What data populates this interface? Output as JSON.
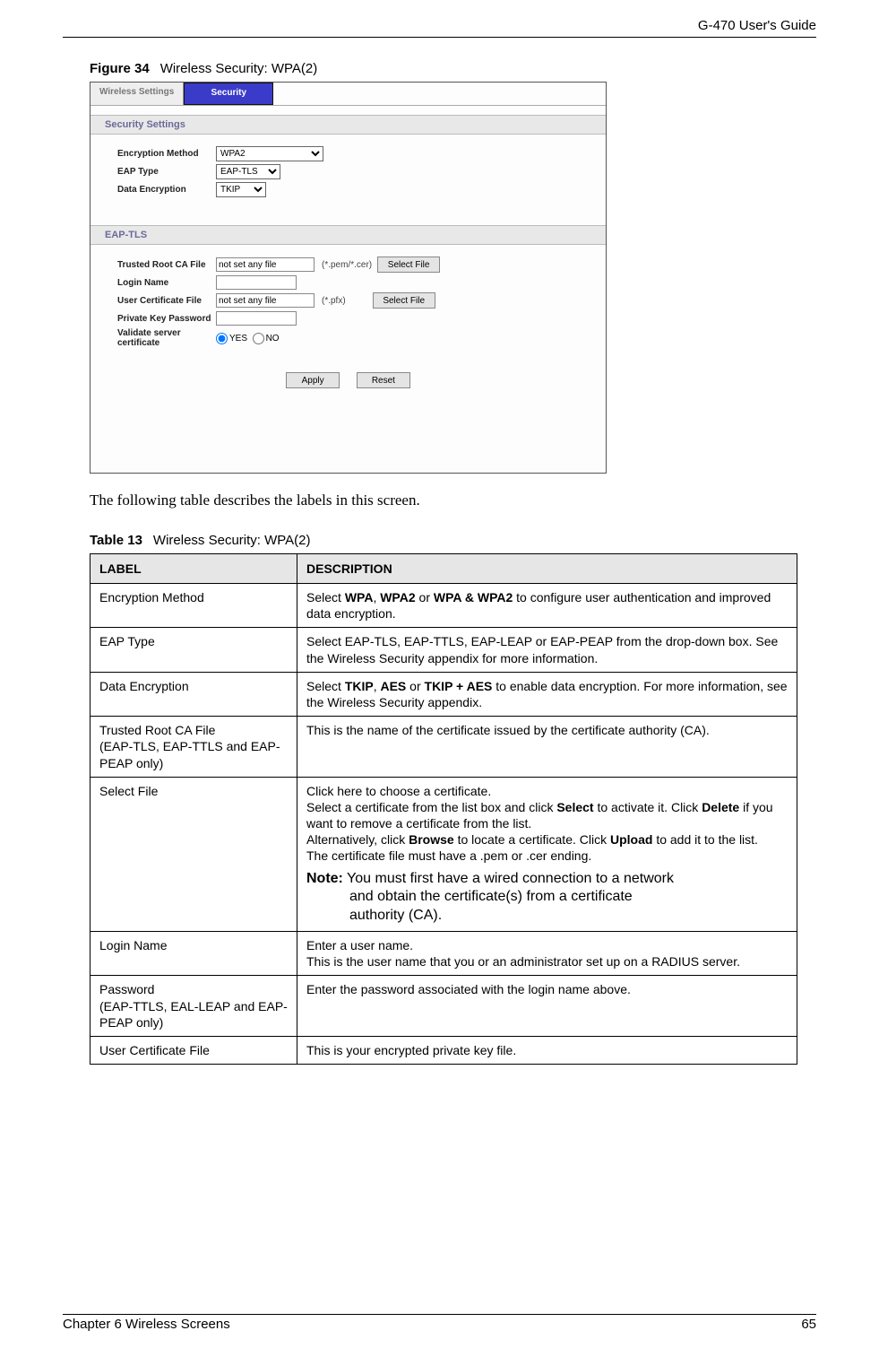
{
  "header": {
    "guide_title": "G-470 User's Guide"
  },
  "figure": {
    "label": "Figure 34",
    "title": "Wireless Security: WPA(2)"
  },
  "ui": {
    "tabs": {
      "wireless": "Wireless Settings",
      "security": "Security"
    },
    "section1": "Security Settings",
    "enc_method_label": "Encryption Method",
    "enc_method_value": "WPA2",
    "eap_type_label": "EAP Type",
    "eap_type_value": "EAP-TLS",
    "data_enc_label": "Data Encryption",
    "data_enc_value": "TKIP",
    "section2": "EAP-TLS",
    "ca_file_label": "Trusted Root CA File",
    "ca_file_value": "not set any file",
    "ca_hint": "(*.pem/*.cer)",
    "select_file_btn": "Select File",
    "login_name_label": "Login Name",
    "user_cert_label": "User Certificate File",
    "user_cert_value": "not set any file",
    "user_cert_hint": "(*.pfx)",
    "pk_pwd_label": "Private Key Password",
    "validate_label": "Validate server certificate",
    "yes": "YES",
    "no": "NO",
    "apply": "Apply",
    "reset": "Reset"
  },
  "body_text": "The following table describes the labels in this screen.",
  "table": {
    "label": "Table 13",
    "title": "Wireless Security: WPA(2)",
    "col1": "LABEL",
    "col2": "DESCRIPTION",
    "rows": [
      {
        "label": "Encryption Method",
        "desc_pre": "Select ",
        "b1": "WPA",
        "sep1": ", ",
        "b2": "WPA2",
        "sep2": " or ",
        "b3": "WPA & WPA2",
        "desc_post": " to configure user authentication and improved data encryption."
      },
      {
        "label": "EAP Type",
        "desc": "Select EAP-TLS, EAP-TTLS, EAP-LEAP or EAP-PEAP from the drop-down box. See the Wireless Security appendix for more information."
      },
      {
        "label": "Data Encryption",
        "desc_pre": "Select ",
        "b1": "TKIP",
        "sep1": ", ",
        "b2": "AES",
        "sep2": " or ",
        "b3": "TKIP + AES",
        "desc_post": " to enable data encryption. For more information, see the Wireless Security appendix."
      },
      {
        "label": "Trusted Root CA File",
        "label_sub": "(EAP-TLS, EAP-TTLS and EAP-PEAP only)",
        "desc": "This is the name of the certificate issued by the certificate authority (CA)."
      },
      {
        "label": "Select File",
        "p1": "Click here to choose a certificate.",
        "p2_pre": "Select a certificate from the list box and click ",
        "p2_b1": "Select",
        "p2_mid": " to activate it. Click ",
        "p2_b2": "Delete",
        "p2_post": " if you want to remove a certificate from the list.",
        "p3_pre": "Alternatively, click ",
        "p3_b1": "Browse",
        "p3_mid": " to locate a certificate. Click ",
        "p3_b2": "Upload",
        "p3_post": " to add it to the list.",
        "p4": "The certificate file must have a .pem or .cer ending.",
        "note_label": "Note:",
        "note_l1": " You must first have a wired connection to a network",
        "note_l2": "and obtain the certificate(s) from a certificate",
        "note_l3": "authority (CA)."
      },
      {
        "label": "Login Name",
        "p1": "Enter a user name.",
        "p2": "This is the user name that you or an administrator set up on a RADIUS server."
      },
      {
        "label": "Password",
        "label_sub": "(EAP-TTLS, EAL-LEAP and EAP-PEAP only)",
        "desc": "Enter the password associated with the login name above."
      },
      {
        "label": "User Certificate File",
        "desc": "This is your encrypted private key file."
      }
    ]
  },
  "footer": {
    "chapter": "Chapter 6 Wireless Screens",
    "page": "65"
  }
}
